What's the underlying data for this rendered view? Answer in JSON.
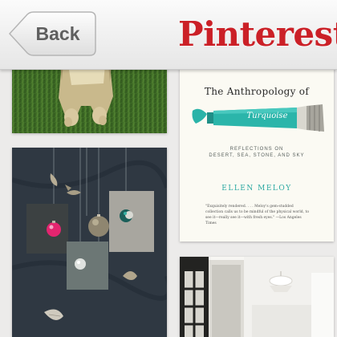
{
  "navbar": {
    "back_label": "Back",
    "logo_text": "Pinterest",
    "brand_color": "#cb2027"
  },
  "pins": [
    {
      "subject": "dog-photo"
    },
    {
      "subject": "book-cover",
      "title": "The Anthropology of",
      "title_word": "Turquoise",
      "subtitle_lines": [
        "REFLECTIONS ON",
        "DESERT, SEA, STONE, AND SKY"
      ],
      "author": "ELLEN MELOY",
      "blurb": "\"Exquisitely rendered. . . . Meloy's gem-studded collection calls us to be mindful of the physical world, to see it—really see it—with fresh eyes.\" —Los Angeles Times",
      "accent_color": "#2aa8a2"
    },
    {
      "subject": "ornaments-photo"
    },
    {
      "subject": "interior-photo"
    }
  ]
}
